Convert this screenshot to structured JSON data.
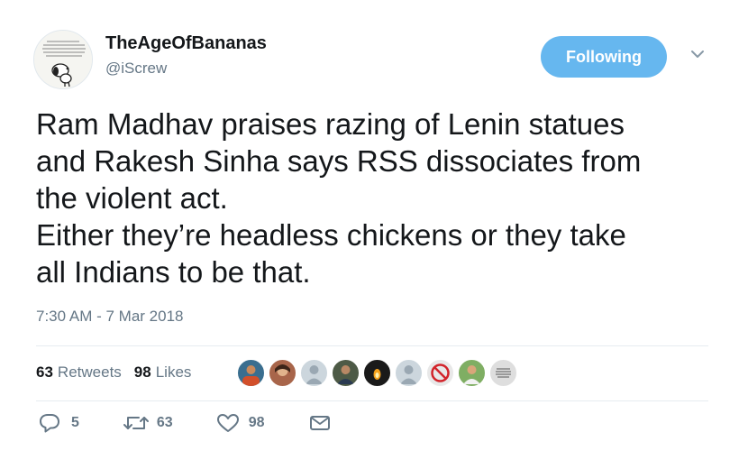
{
  "tweet": {
    "display_name": "TheAgeOfBananas",
    "handle": "@iScrew",
    "follow_label": "Following",
    "text": "Ram Madhav praises razing of Lenin statues\nand Rakesh Sinha says RSS dissociates from\nthe violent act.\nEither they’re headless chickens or they take\nall Indians to be that.",
    "timestamp": "7:30 AM - 7 Mar 2018"
  },
  "stats": {
    "retweets_count": "63",
    "retweets_label": "Retweets",
    "likes_count": "98",
    "likes_label": "Likes"
  },
  "likers": [
    {
      "color": "#3a6e8f"
    },
    {
      "color": "#a8654a"
    },
    {
      "color": "#ccd6dd"
    },
    {
      "color": "#4d5a46"
    },
    {
      "color": "#1a1a1a"
    },
    {
      "color": "#ccd6dd"
    },
    {
      "color": "#e8e8e8"
    },
    {
      "color": "#7fae63"
    },
    {
      "color": "#dedede"
    }
  ],
  "actions": {
    "reply_count": "5",
    "retweet_count": "63",
    "like_count": "98"
  },
  "colors": {
    "accent": "#1da1f2",
    "follow_bg": "#66b7ef",
    "secondary_text": "#657786"
  }
}
